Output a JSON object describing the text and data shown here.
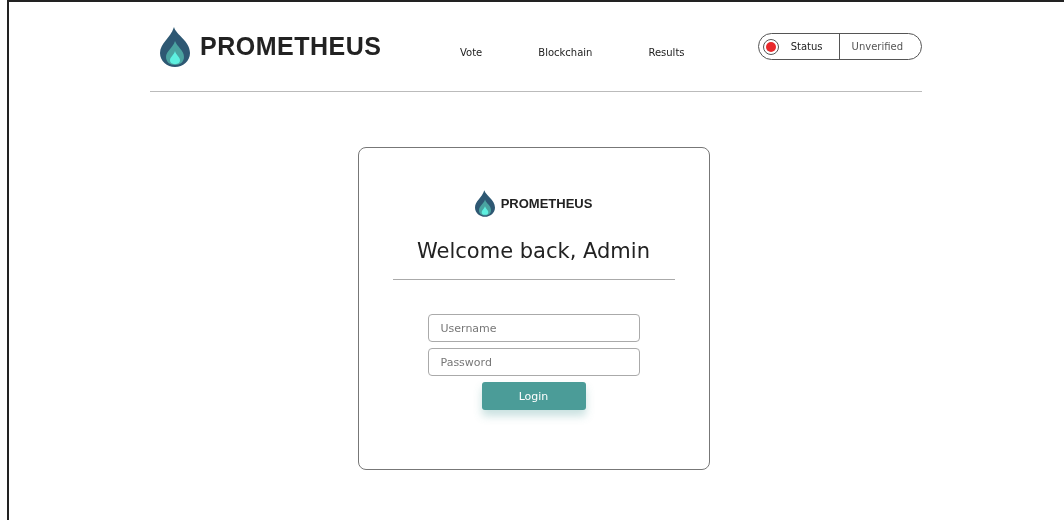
{
  "header": {
    "brand": "PROMETHEUS",
    "nav": [
      {
        "label": "Vote"
      },
      {
        "label": "Blockchain"
      },
      {
        "label": "Results"
      }
    ],
    "status": {
      "label": "Status",
      "value": "Unverified",
      "verified": false
    }
  },
  "login_card": {
    "brand": "PROMETHEUS",
    "title": "Welcome back, Admin",
    "fields": [
      {
        "placeholder": "Username"
      },
      {
        "placeholder": "Password"
      }
    ],
    "button": "Login"
  }
}
